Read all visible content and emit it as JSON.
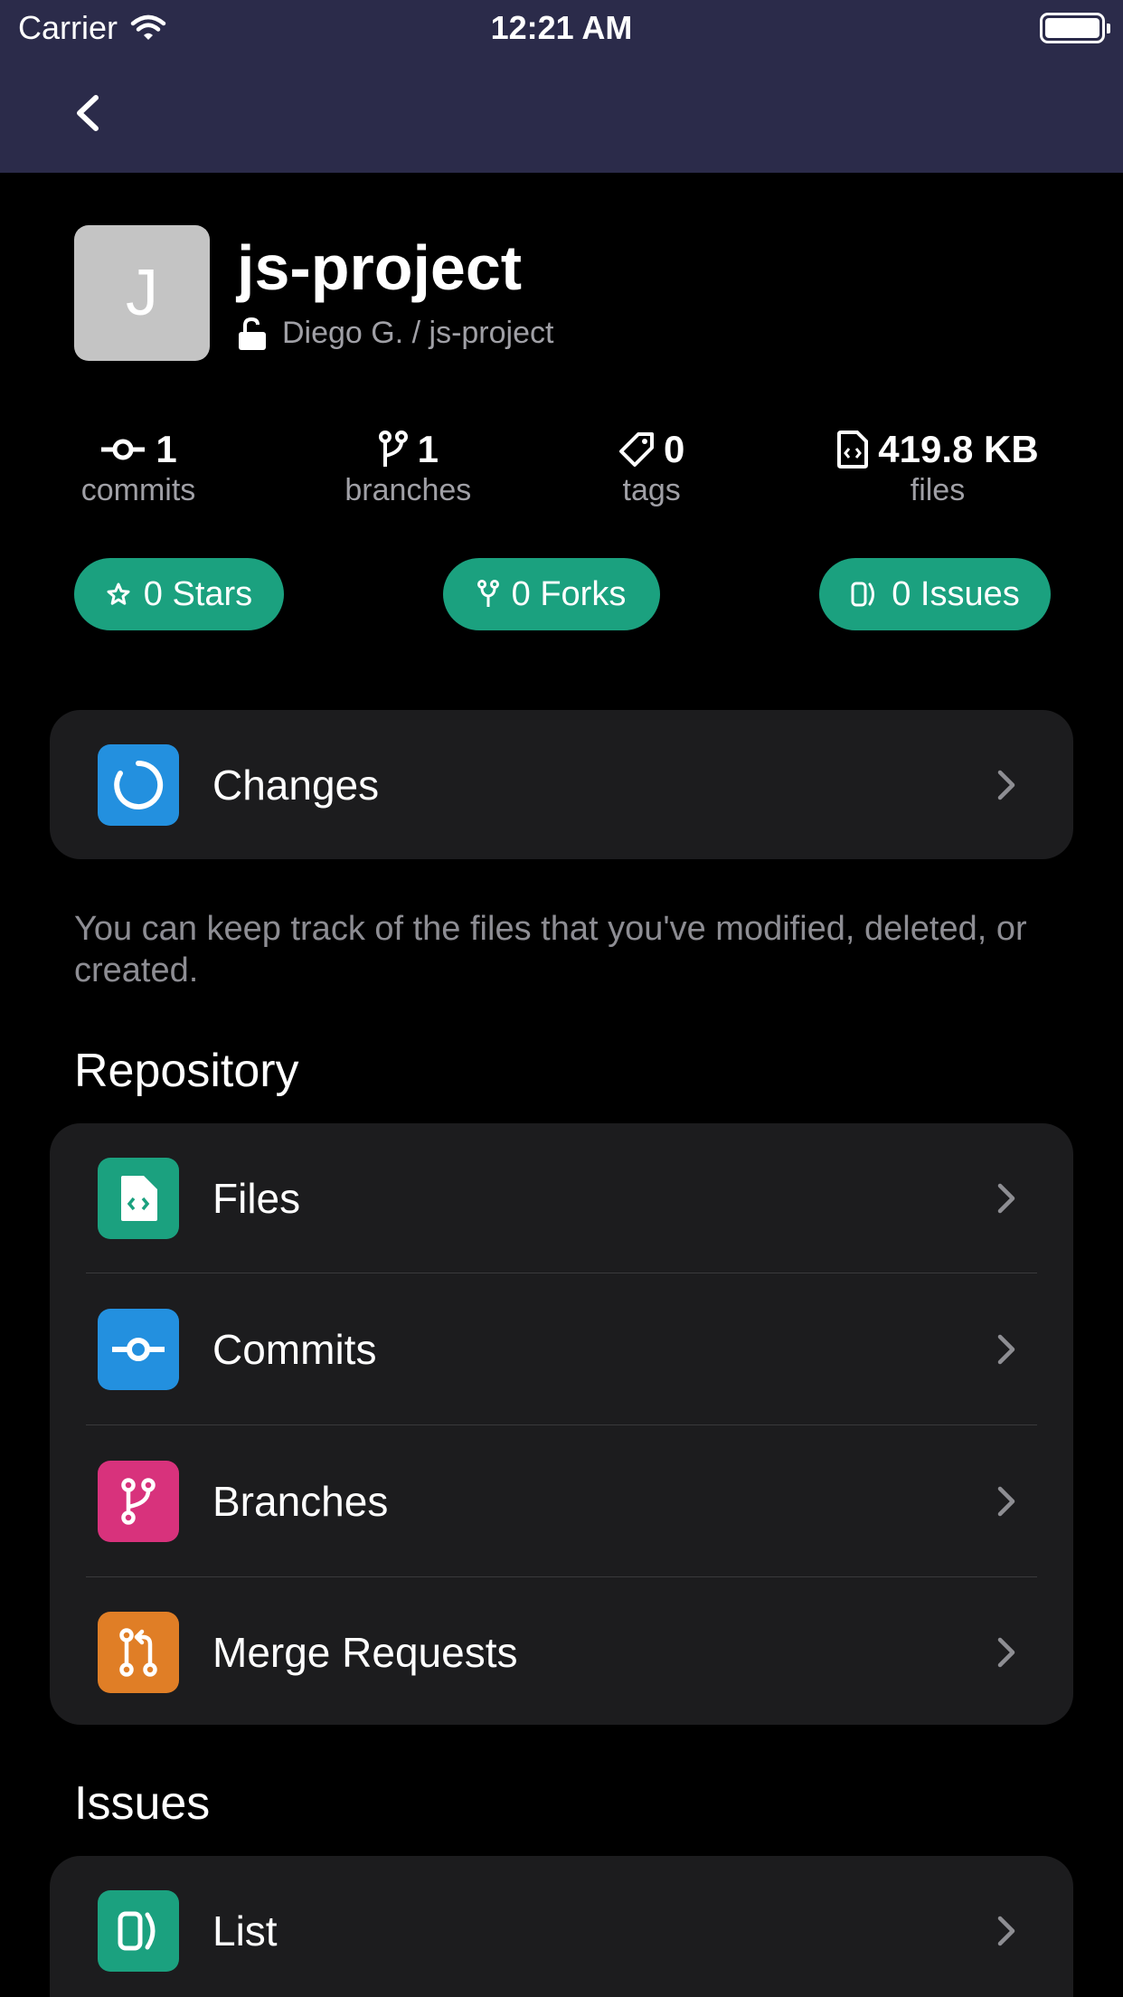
{
  "status": {
    "carrier": "Carrier",
    "time": "12:21 AM"
  },
  "repo": {
    "initial": "J",
    "name": "js-project",
    "path": "Diego G. / js-project"
  },
  "stats": [
    {
      "icon": "commit-icon",
      "value": "1",
      "label": "commits"
    },
    {
      "icon": "branch-icon",
      "value": "1",
      "label": "branches"
    },
    {
      "icon": "tag-icon",
      "value": "0",
      "label": "tags"
    },
    {
      "icon": "file-code-icon",
      "value": "419.8 KB",
      "label": "files"
    }
  ],
  "pills": {
    "stars": "0 Stars",
    "forks": "0 Forks",
    "issues": "0 Issues"
  },
  "changes": {
    "label": "Changes",
    "hint": "You can keep track of the files that you've modified, deleted, or created."
  },
  "sections": {
    "repository": "Repository",
    "issues": "Issues"
  },
  "repository_items": [
    {
      "label": "Files",
      "icon": "file-code-icon",
      "color": "#1ba17f"
    },
    {
      "label": "Commits",
      "icon": "commit-icon",
      "color": "#2390df"
    },
    {
      "label": "Branches",
      "icon": "branch-icon",
      "color": "#d8327c"
    },
    {
      "label": "Merge Requests",
      "icon": "merge-request-icon",
      "color": "#e07e26"
    }
  ],
  "issues_items": [
    {
      "label": "List",
      "icon": "issues-icon",
      "color": "#1ba17f"
    }
  ],
  "colors": {
    "nav_bar": "#2b2b4a",
    "accent_green": "#1ba17f",
    "accent_blue": "#2390df"
  }
}
